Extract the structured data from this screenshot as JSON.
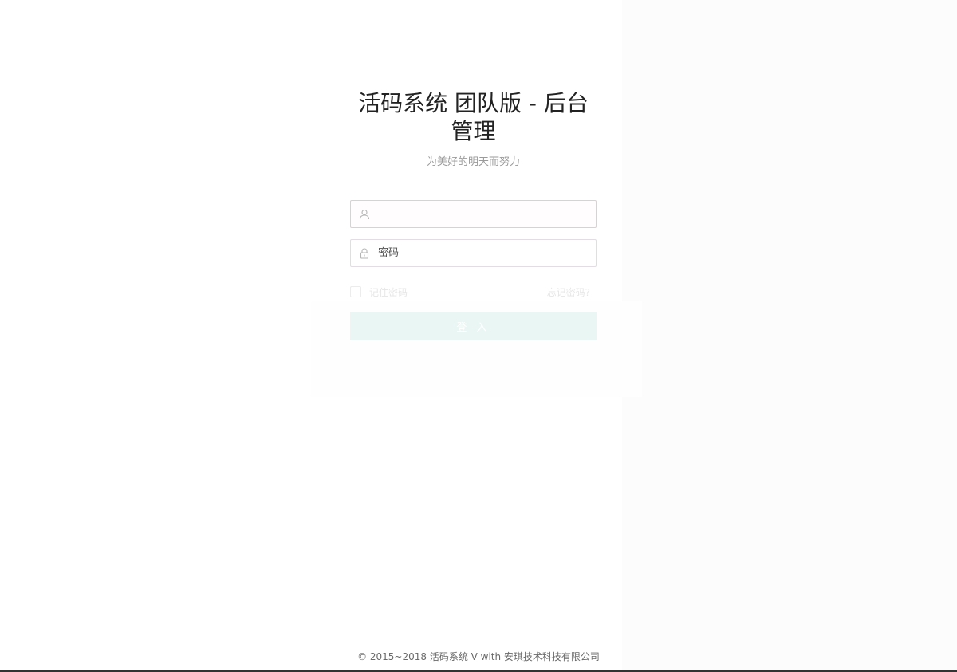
{
  "login": {
    "title": "活码系统 团队版 - 后台管理",
    "subtitle": "为美好的明天而努力",
    "username": {
      "icon": "user-icon",
      "value": "",
      "placeholder": ""
    },
    "password": {
      "icon": "lock-icon",
      "value": "",
      "placeholder": "密码"
    },
    "remember_label": "记住密码",
    "forgot_label": "忘记密码?",
    "submit_label": "登 入"
  },
  "footer": {
    "text": "© 2015~2018 活码系统 V with 安琪技术科技有限公司"
  },
  "colors": {
    "button_bg": "#eaf6f4",
    "input_border": "#e2dde2",
    "title": "#222222",
    "subtitle": "#9a9a9a"
  }
}
